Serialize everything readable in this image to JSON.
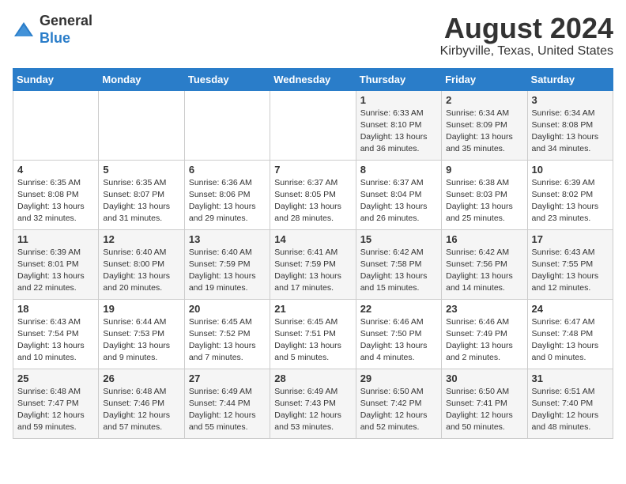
{
  "header": {
    "logo_general": "General",
    "logo_blue": "Blue",
    "month_year": "August 2024",
    "location": "Kirbyville, Texas, United States"
  },
  "days_of_week": [
    "Sunday",
    "Monday",
    "Tuesday",
    "Wednesday",
    "Thursday",
    "Friday",
    "Saturday"
  ],
  "weeks": [
    [
      {
        "day": "",
        "info": ""
      },
      {
        "day": "",
        "info": ""
      },
      {
        "day": "",
        "info": ""
      },
      {
        "day": "",
        "info": ""
      },
      {
        "day": "1",
        "info": "Sunrise: 6:33 AM\nSunset: 8:10 PM\nDaylight: 13 hours\nand 36 minutes."
      },
      {
        "day": "2",
        "info": "Sunrise: 6:34 AM\nSunset: 8:09 PM\nDaylight: 13 hours\nand 35 minutes."
      },
      {
        "day": "3",
        "info": "Sunrise: 6:34 AM\nSunset: 8:08 PM\nDaylight: 13 hours\nand 34 minutes."
      }
    ],
    [
      {
        "day": "4",
        "info": "Sunrise: 6:35 AM\nSunset: 8:08 PM\nDaylight: 13 hours\nand 32 minutes."
      },
      {
        "day": "5",
        "info": "Sunrise: 6:35 AM\nSunset: 8:07 PM\nDaylight: 13 hours\nand 31 minutes."
      },
      {
        "day": "6",
        "info": "Sunrise: 6:36 AM\nSunset: 8:06 PM\nDaylight: 13 hours\nand 29 minutes."
      },
      {
        "day": "7",
        "info": "Sunrise: 6:37 AM\nSunset: 8:05 PM\nDaylight: 13 hours\nand 28 minutes."
      },
      {
        "day": "8",
        "info": "Sunrise: 6:37 AM\nSunset: 8:04 PM\nDaylight: 13 hours\nand 26 minutes."
      },
      {
        "day": "9",
        "info": "Sunrise: 6:38 AM\nSunset: 8:03 PM\nDaylight: 13 hours\nand 25 minutes."
      },
      {
        "day": "10",
        "info": "Sunrise: 6:39 AM\nSunset: 8:02 PM\nDaylight: 13 hours\nand 23 minutes."
      }
    ],
    [
      {
        "day": "11",
        "info": "Sunrise: 6:39 AM\nSunset: 8:01 PM\nDaylight: 13 hours\nand 22 minutes."
      },
      {
        "day": "12",
        "info": "Sunrise: 6:40 AM\nSunset: 8:00 PM\nDaylight: 13 hours\nand 20 minutes."
      },
      {
        "day": "13",
        "info": "Sunrise: 6:40 AM\nSunset: 7:59 PM\nDaylight: 13 hours\nand 19 minutes."
      },
      {
        "day": "14",
        "info": "Sunrise: 6:41 AM\nSunset: 7:59 PM\nDaylight: 13 hours\nand 17 minutes."
      },
      {
        "day": "15",
        "info": "Sunrise: 6:42 AM\nSunset: 7:58 PM\nDaylight: 13 hours\nand 15 minutes."
      },
      {
        "day": "16",
        "info": "Sunrise: 6:42 AM\nSunset: 7:56 PM\nDaylight: 13 hours\nand 14 minutes."
      },
      {
        "day": "17",
        "info": "Sunrise: 6:43 AM\nSunset: 7:55 PM\nDaylight: 13 hours\nand 12 minutes."
      }
    ],
    [
      {
        "day": "18",
        "info": "Sunrise: 6:43 AM\nSunset: 7:54 PM\nDaylight: 13 hours\nand 10 minutes."
      },
      {
        "day": "19",
        "info": "Sunrise: 6:44 AM\nSunset: 7:53 PM\nDaylight: 13 hours\nand 9 minutes."
      },
      {
        "day": "20",
        "info": "Sunrise: 6:45 AM\nSunset: 7:52 PM\nDaylight: 13 hours\nand 7 minutes."
      },
      {
        "day": "21",
        "info": "Sunrise: 6:45 AM\nSunset: 7:51 PM\nDaylight: 13 hours\nand 5 minutes."
      },
      {
        "day": "22",
        "info": "Sunrise: 6:46 AM\nSunset: 7:50 PM\nDaylight: 13 hours\nand 4 minutes."
      },
      {
        "day": "23",
        "info": "Sunrise: 6:46 AM\nSunset: 7:49 PM\nDaylight: 13 hours\nand 2 minutes."
      },
      {
        "day": "24",
        "info": "Sunrise: 6:47 AM\nSunset: 7:48 PM\nDaylight: 13 hours\nand 0 minutes."
      }
    ],
    [
      {
        "day": "25",
        "info": "Sunrise: 6:48 AM\nSunset: 7:47 PM\nDaylight: 12 hours\nand 59 minutes."
      },
      {
        "day": "26",
        "info": "Sunrise: 6:48 AM\nSunset: 7:46 PM\nDaylight: 12 hours\nand 57 minutes."
      },
      {
        "day": "27",
        "info": "Sunrise: 6:49 AM\nSunset: 7:44 PM\nDaylight: 12 hours\nand 55 minutes."
      },
      {
        "day": "28",
        "info": "Sunrise: 6:49 AM\nSunset: 7:43 PM\nDaylight: 12 hours\nand 53 minutes."
      },
      {
        "day": "29",
        "info": "Sunrise: 6:50 AM\nSunset: 7:42 PM\nDaylight: 12 hours\nand 52 minutes."
      },
      {
        "day": "30",
        "info": "Sunrise: 6:50 AM\nSunset: 7:41 PM\nDaylight: 12 hours\nand 50 minutes."
      },
      {
        "day": "31",
        "info": "Sunrise: 6:51 AM\nSunset: 7:40 PM\nDaylight: 12 hours\nand 48 minutes."
      }
    ]
  ]
}
